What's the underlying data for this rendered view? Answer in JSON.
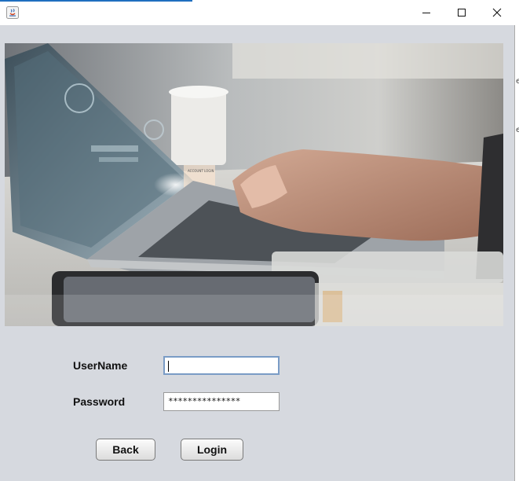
{
  "window": {
    "title": "",
    "controls": {
      "minimize_icon": "minimize-icon",
      "maximize_icon": "maximize-icon",
      "close_icon": "close-icon"
    },
    "accent_color": "#1f6fbf",
    "background_color": "#d6d9df"
  },
  "hero_image": {
    "description_icon": "laptop-photo",
    "overlay_text": "ACCOUNT LOGIN"
  },
  "form": {
    "username": {
      "label": "UserName",
      "value": ""
    },
    "password": {
      "label": "Password",
      "value": "***************"
    }
  },
  "buttons": {
    "back_label": "Back",
    "login_label": "Login"
  },
  "edge": {
    "glyph_1": "e",
    "glyph_2": "e"
  }
}
